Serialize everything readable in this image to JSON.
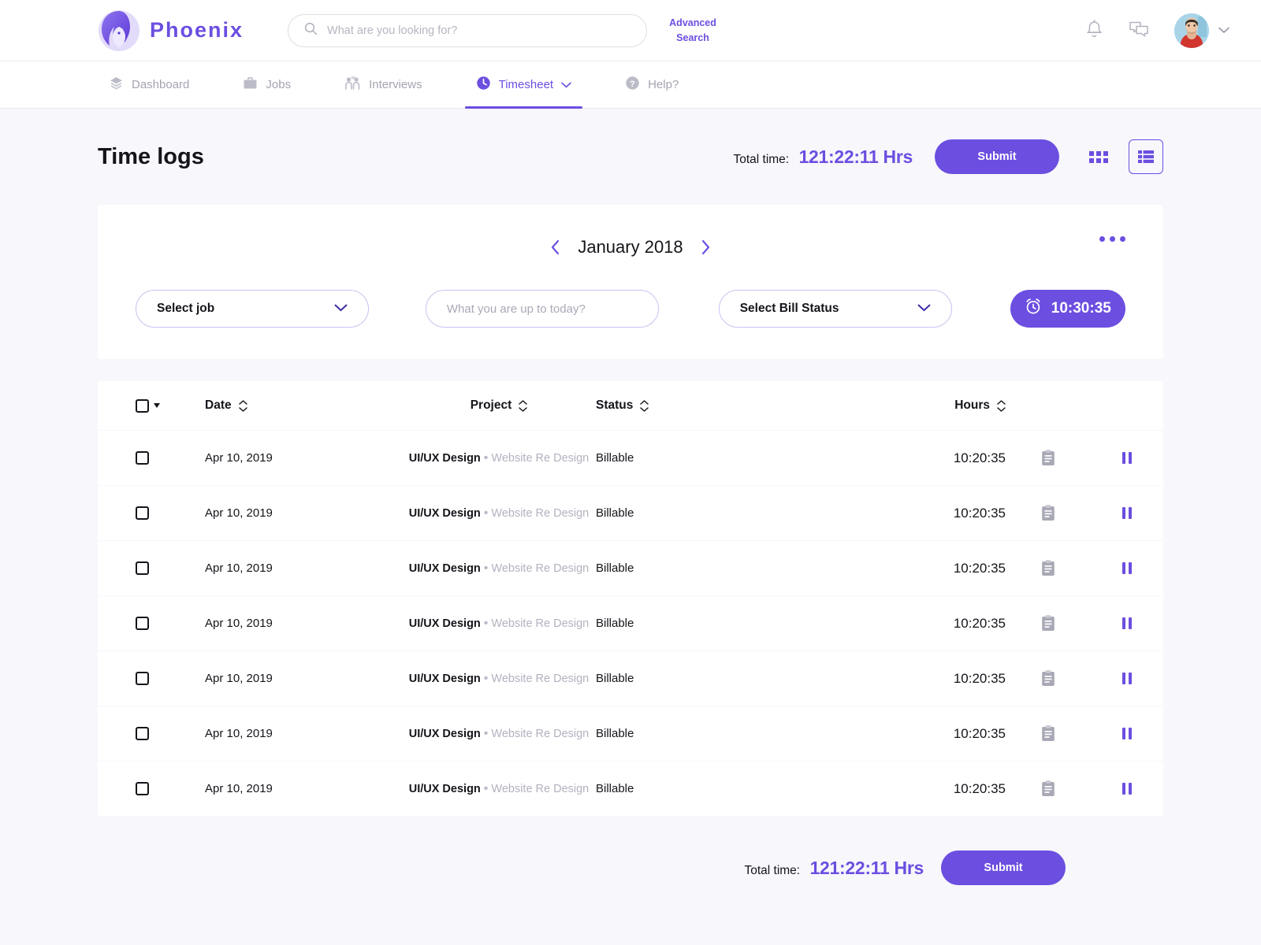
{
  "brand": {
    "name": "Phoenix",
    "logo_icon": "phoenix-bird-logo"
  },
  "search": {
    "placeholder": "What are you looking for?",
    "value": "",
    "icon": "search-icon",
    "advanced_line1": "Advanced",
    "advanced_line2": "Search"
  },
  "topbar_icons": {
    "notifications": "bell-icon",
    "messages": "chat-bubbles-icon",
    "avatar": "user-avatar",
    "account_caret": "chevron-down-icon"
  },
  "nav": {
    "items": [
      {
        "label": "Dashboard",
        "icon": "layers-icon",
        "active": false,
        "caret": false
      },
      {
        "label": "Jobs",
        "icon": "briefcase-icon",
        "active": false,
        "caret": false
      },
      {
        "label": "Interviews",
        "icon": "interview-icon",
        "active": false,
        "caret": false
      },
      {
        "label": "Timesheet",
        "icon": "clock-icon",
        "active": true,
        "caret": true
      },
      {
        "label": "Help?",
        "icon": "question-icon",
        "active": false,
        "caret": false
      }
    ]
  },
  "header": {
    "title": "Time logs",
    "total_time_label": "Total time:",
    "total_time_value": "121:22:11 Hrs",
    "submit_label": "Submit",
    "view_grid_icon": "grid-view-icon",
    "view_list_icon": "list-view-icon",
    "active_view": "list"
  },
  "entry": {
    "month_label": "January 2018",
    "prev_icon": "chevron-left-icon",
    "next_icon": "chevron-right-icon",
    "more_icon": "more-options-icon",
    "job_select": "Select job",
    "task_placeholder": "What you are up to today?",
    "task_value": "",
    "bill_select": "Select Bill Status",
    "timer_value": "10:30:35",
    "timer_icon": "alarm-clock-icon"
  },
  "table": {
    "columns": [
      {
        "key": "date",
        "label": "Date",
        "sortable": true
      },
      {
        "key": "proj",
        "label": "Project",
        "sortable": true
      },
      {
        "key": "status",
        "label": "Status",
        "sortable": true
      },
      {
        "key": "hours",
        "label": "Hours",
        "sortable": true
      }
    ],
    "rows": [
      {
        "date": "Apr 10, 2019",
        "project": "UI/UX Design",
        "project_sub": "Website Re Design",
        "status": "Billable",
        "hours": "10:20:35"
      },
      {
        "date": "Apr 10, 2019",
        "project": "UI/UX Design",
        "project_sub": "Website Re Design",
        "status": "Billable",
        "hours": "10:20:35"
      },
      {
        "date": "Apr 10, 2019",
        "project": "UI/UX Design",
        "project_sub": "Website Re Design",
        "status": "Billable",
        "hours": "10:20:35"
      },
      {
        "date": "Apr 10, 2019",
        "project": "UI/UX Design",
        "project_sub": "Website Re Design",
        "status": "Billable",
        "hours": "10:20:35"
      },
      {
        "date": "Apr 10, 2019",
        "project": "UI/UX Design",
        "project_sub": "Website Re Design",
        "status": "Billable",
        "hours": "10:20:35"
      },
      {
        "date": "Apr 10, 2019",
        "project": "UI/UX Design",
        "project_sub": "Website Re Design",
        "status": "Billable",
        "hours": "10:20:35"
      },
      {
        "date": "Apr 10, 2019",
        "project": "UI/UX Design",
        "project_sub": "Website Re Design",
        "status": "Billable",
        "hours": "10:20:35"
      }
    ],
    "row_note_icon": "clipboard-note-icon",
    "row_action_icon": "pause-icon",
    "separator": "•"
  },
  "footer": {
    "total_time_label": "Total time:",
    "total_time_value": "121:22:11 Hrs",
    "submit_label": "Submit"
  },
  "colors": {
    "accent": "#6c4ee0",
    "accent_border": "#cbc0f2",
    "page_bg": "#f7f7fc",
    "card_bg": "#ffffff",
    "text": "#15141a",
    "muted": "#b2b2c0"
  }
}
